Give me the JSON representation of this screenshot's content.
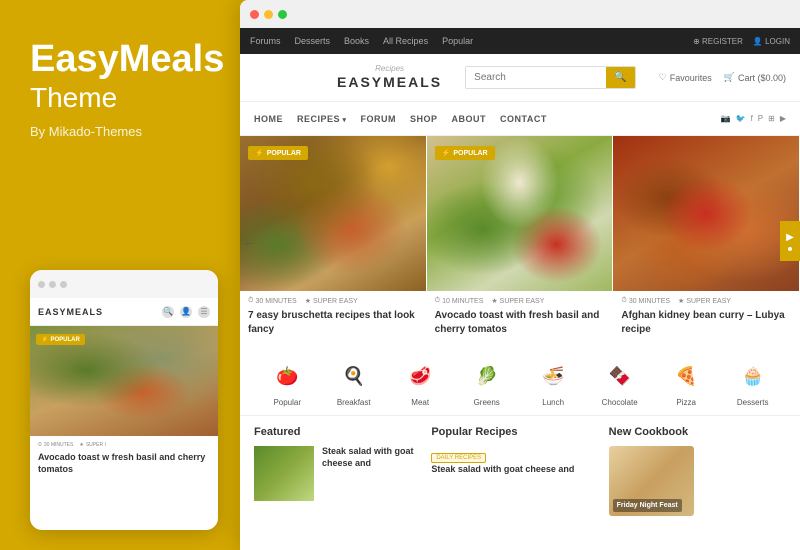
{
  "brand": {
    "title": "EasyMeals",
    "subtitle": "Theme",
    "by": "By Mikado-Themes"
  },
  "browser": {
    "top_nav": {
      "links": [
        "Forums",
        "Desserts",
        "Books",
        "All Recipes",
        "Popular"
      ],
      "right_items": [
        "REGISTER",
        "LOGIN"
      ]
    },
    "header": {
      "logo_script": "Recipes",
      "logo_main": "EASYMEALS",
      "search_placeholder": "Search",
      "favourites": "Favourites",
      "cart": "Cart ($0.00)"
    },
    "main_nav": {
      "links": [
        "HOME",
        "RECIPES",
        "FORUM",
        "SHOP",
        "ABOUT",
        "CONTACT"
      ]
    }
  },
  "recipe_cards": [
    {
      "badge": "POPULAR",
      "meta_time": "30 MINUTES",
      "meta_ease": "SUPER EASY",
      "title": "7 easy bruschetta recipes that look fancy"
    },
    {
      "badge": "POPULAR",
      "meta_time": "10 MINUTES",
      "meta_ease": "SUPER EASY",
      "title": "Avocado toast with fresh basil and cherry tomatos"
    },
    {
      "badge": null,
      "meta_time": "30 MINUTES",
      "meta_ease": "SUPER EASY",
      "title": "Afghan kidney bean curry – Lubya recipe"
    }
  ],
  "categories": [
    {
      "icon": "🍅",
      "label": "Popular"
    },
    {
      "icon": "🍳",
      "label": "Breakfast"
    },
    {
      "icon": "🥩",
      "label": "Meat"
    },
    {
      "icon": "🥬",
      "label": "Greens"
    },
    {
      "icon": "🍜",
      "label": "Lunch"
    },
    {
      "icon": "🍫",
      "label": "Chocolate"
    },
    {
      "icon": "🍕",
      "label": "Pizza"
    },
    {
      "icon": "🧁",
      "label": "Desserts"
    }
  ],
  "bottom": {
    "featured": {
      "title": "Featured",
      "item_title": "Steak salad with goat cheese and"
    },
    "popular_recipes": {
      "title": "Popular Recipes",
      "badge": "DAILY RECIPES",
      "item_title": "Steak salad with goat cheese and"
    },
    "new_cookbook": {
      "title": "New Cookbook",
      "book_title": "Friday Night Feast"
    }
  },
  "mobile": {
    "brand": "EASYMEALS",
    "popular_badge": "POPULAR",
    "recipe_title": "Avocado toast w fresh basil and cherry tomatos",
    "meta_time": "30 MINUTES",
    "meta_ease": "SUPER I"
  }
}
